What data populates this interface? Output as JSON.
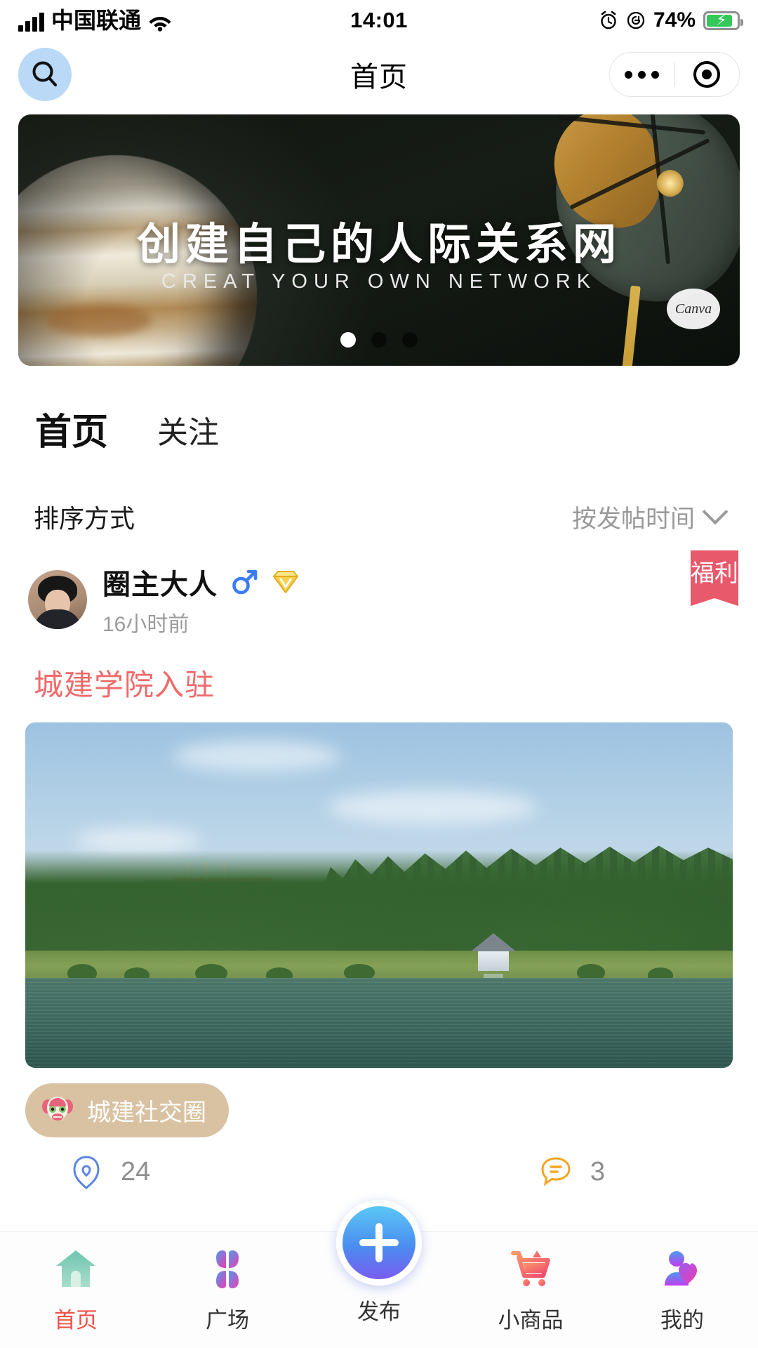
{
  "status_bar": {
    "carrier": "中国联通",
    "time": "14:01",
    "battery_percent": "74%",
    "icons": [
      "signal-bars-icon",
      "wifi-icon",
      "alarm-icon",
      "rotation-lock-icon",
      "battery-charging-icon"
    ]
  },
  "nav": {
    "title": "首页",
    "search_icon": "search-icon",
    "capsule": {
      "more_icon": "more-dots-icon",
      "target_icon": "target-icon"
    }
  },
  "banner": {
    "headline": "创建自己的人际关系网",
    "subhead": "CREAT YOUR OWN NETWORK",
    "watermark": "Canva",
    "dots_total": 3,
    "dots_active_index": 0
  },
  "tabs": [
    {
      "label": "首页",
      "active": true
    },
    {
      "label": "关注",
      "active": false
    }
  ],
  "sort": {
    "label": "排序方式",
    "value": "按发帖时间",
    "chevron_icon": "chevron-down-icon"
  },
  "post": {
    "author": "圈主大人",
    "gender_icon": "male-gender-icon",
    "vip_icon": "vip-diamond-icon",
    "time": "16小时前",
    "ribbon": "福利",
    "title": "城建学院入驻",
    "circle_tag": "城建社交圈",
    "circle_tag_icon": "lion-head-icon",
    "like_count": "24",
    "comment_count": "3",
    "like_icon": "heart-outline-icon",
    "comment_icon": "comment-bubble-icon"
  },
  "tabbar": [
    {
      "label": "首页",
      "icon": "home-icon",
      "active": true
    },
    {
      "label": "广场",
      "icon": "plaza-icon",
      "active": false
    },
    {
      "label": "发布",
      "icon": "publish-icon",
      "active": false
    },
    {
      "label": "小商品",
      "icon": "cart-icon",
      "active": false
    },
    {
      "label": "我的",
      "icon": "profile-icon",
      "active": false
    }
  ],
  "colors": {
    "accent_yellow": "#f5b731",
    "title_red": "#ef6a6a",
    "ribbon_red": "#e8596b",
    "active_tab_red": "#f0504a",
    "chip_tan": "#d9c2a2",
    "search_blue": "#b9d9f7"
  }
}
